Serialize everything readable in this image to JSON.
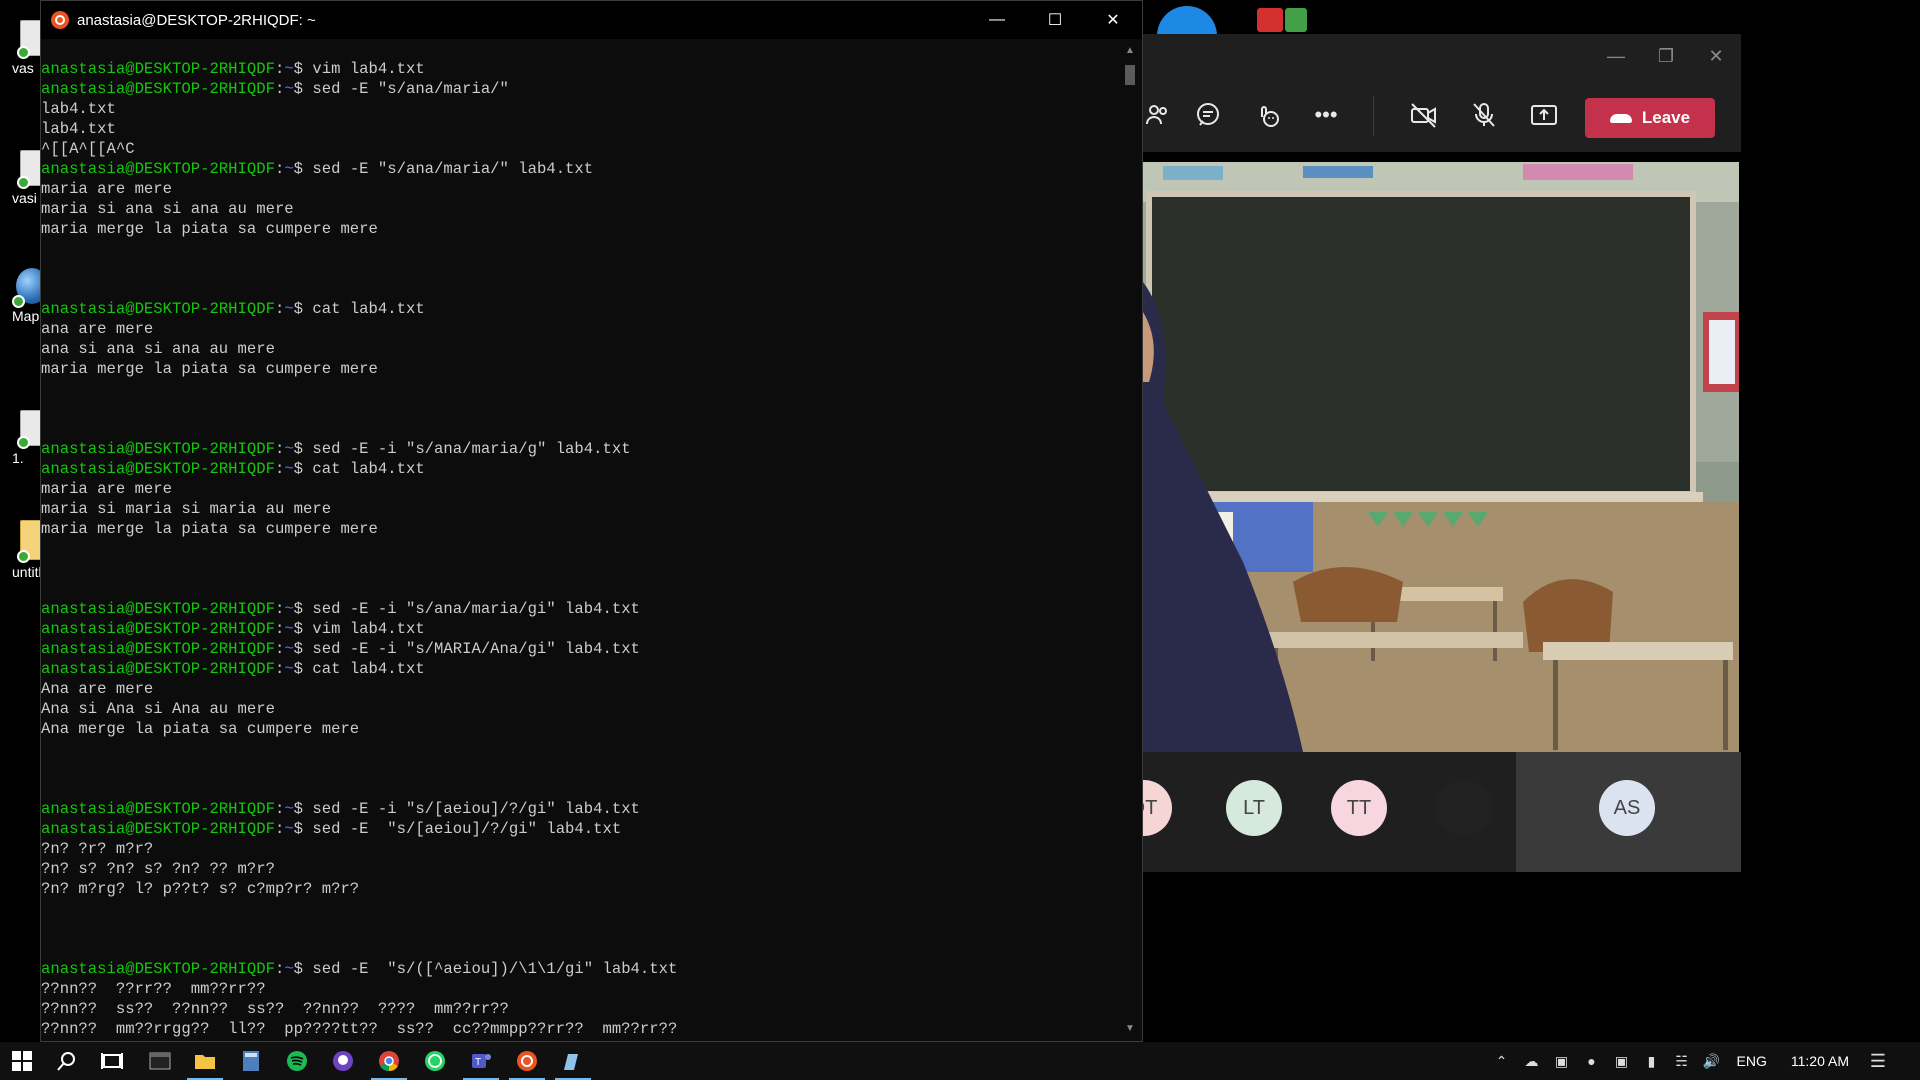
{
  "terminal": {
    "title": "anastasia@DESKTOP-2RHIQDF: ~",
    "user": "anastasia@DESKTOP-2RHIQDF",
    "path": "~",
    "lines": [
      {
        "type": "prompt",
        "cmd": " vim lab4.txt"
      },
      {
        "type": "prompt",
        "cmd": " sed -E \"s/ana/maria/\""
      },
      {
        "type": "out",
        "text": "lab4.txt"
      },
      {
        "type": "out",
        "text": "lab4.txt"
      },
      {
        "type": "out",
        "text": "^[[A^[[A^C"
      },
      {
        "type": "prompt",
        "cmd": " sed -E \"s/ana/maria/\" lab4.txt"
      },
      {
        "type": "out",
        "text": "maria are mere"
      },
      {
        "type": "out",
        "text": "maria si ana si ana au mere"
      },
      {
        "type": "out",
        "text": "maria merge la piata sa cumpere mere"
      },
      {
        "type": "out",
        "text": ""
      },
      {
        "type": "out",
        "text": ""
      },
      {
        "type": "out",
        "text": ""
      },
      {
        "type": "prompt",
        "cmd": " cat lab4.txt"
      },
      {
        "type": "out",
        "text": "ana are mere"
      },
      {
        "type": "out",
        "text": "ana si ana si ana au mere"
      },
      {
        "type": "out",
        "text": "maria merge la piata sa cumpere mere"
      },
      {
        "type": "out",
        "text": ""
      },
      {
        "type": "out",
        "text": ""
      },
      {
        "type": "out",
        "text": ""
      },
      {
        "type": "prompt",
        "cmd": " sed -E -i \"s/ana/maria/g\" lab4.txt"
      },
      {
        "type": "prompt",
        "cmd": " cat lab4.txt"
      },
      {
        "type": "out",
        "text": "maria are mere"
      },
      {
        "type": "out",
        "text": "maria si maria si maria au mere"
      },
      {
        "type": "out",
        "text": "maria merge la piata sa cumpere mere"
      },
      {
        "type": "out",
        "text": ""
      },
      {
        "type": "out",
        "text": ""
      },
      {
        "type": "out",
        "text": ""
      },
      {
        "type": "prompt",
        "cmd": " sed -E -i \"s/ana/maria/gi\" lab4.txt"
      },
      {
        "type": "prompt",
        "cmd": " vim lab4.txt"
      },
      {
        "type": "prompt",
        "cmd": " sed -E -i \"s/MARIA/Ana/gi\" lab4.txt"
      },
      {
        "type": "prompt",
        "cmd": " cat lab4.txt"
      },
      {
        "type": "out",
        "text": "Ana are mere"
      },
      {
        "type": "out",
        "text": "Ana si Ana si Ana au mere"
      },
      {
        "type": "out",
        "text": "Ana merge la piata sa cumpere mere"
      },
      {
        "type": "out",
        "text": ""
      },
      {
        "type": "out",
        "text": ""
      },
      {
        "type": "out",
        "text": ""
      },
      {
        "type": "prompt",
        "cmd": " sed -E -i \"s/[aeiou]/?/gi\" lab4.txt"
      },
      {
        "type": "prompt",
        "cmd": " sed -E  \"s/[aeiou]/?/gi\" lab4.txt"
      },
      {
        "type": "out",
        "text": "?n? ?r? m?r?"
      },
      {
        "type": "out",
        "text": "?n? s? ?n? s? ?n? ?? m?r?"
      },
      {
        "type": "out",
        "text": "?n? m?rg? l? p??t? s? c?mp?r? m?r?"
      },
      {
        "type": "out",
        "text": ""
      },
      {
        "type": "out",
        "text": ""
      },
      {
        "type": "out",
        "text": ""
      },
      {
        "type": "prompt",
        "cmd": " sed -E  \"s/([^aeiou])/\\1\\1/gi\" lab4.txt"
      },
      {
        "type": "out",
        "text": "??nn??  ??rr??  mm??rr??"
      },
      {
        "type": "out",
        "text": "??nn??  ss??  ??nn??  ss??  ??nn??  ????  mm??rr??"
      },
      {
        "type": "out",
        "text": "??nn??  mm??rrgg??  ll??  pp????tt??  ss??  cc??mmpp??rr??  mm??rr??"
      }
    ]
  },
  "desktop": {
    "icons": [
      {
        "label": "vas",
        "kind": "doc"
      },
      {
        "label": "vasi",
        "kind": "doc"
      },
      {
        "label": "Map",
        "kind": "globe"
      },
      {
        "label": "1.",
        "kind": "doc"
      },
      {
        "label": "untitl",
        "kind": "folder"
      }
    ]
  },
  "teams": {
    "leave_label": "Leave",
    "participants": [
      {
        "initials": "DT",
        "color": "#f6d5d5"
      },
      {
        "initials": "LT",
        "color": "#d6e9dd"
      },
      {
        "initials": "TT",
        "color": "#f7d6df"
      },
      {
        "initials": "",
        "color": "#222222"
      },
      {
        "initials": "AS",
        "color": "#dbe3f0"
      }
    ]
  },
  "taskbar": {
    "language": "ENG",
    "time": "11:20 AM"
  },
  "colors": {
    "prompt_user": "#16c60c",
    "prompt_path": "#3b78ff",
    "leave": "#c4314b"
  }
}
